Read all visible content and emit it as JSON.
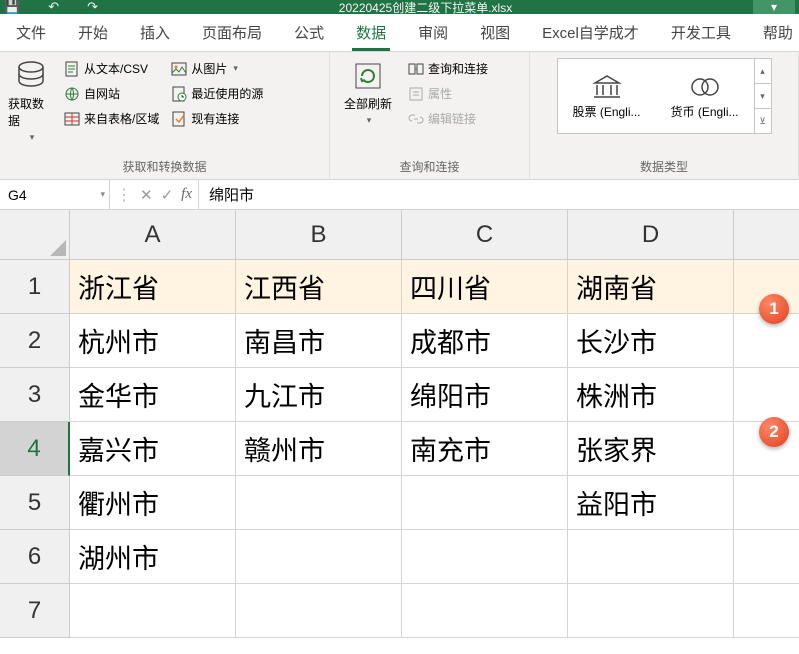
{
  "titlebar": {
    "filename": "20220425创建二级下拉菜单.xlsx"
  },
  "tabs": [
    "文件",
    "开始",
    "插入",
    "页面布局",
    "公式",
    "数据",
    "审阅",
    "视图",
    "Excel自学成才",
    "开发工具",
    "帮助"
  ],
  "active_tab_index": 5,
  "ribbon": {
    "group1": {
      "big": "获取数据",
      "items": [
        "从文本/CSV",
        "自网站",
        "来自表格/区域"
      ],
      "items2": [
        "从图片",
        "最近使用的源",
        "现有连接"
      ],
      "label": "获取和转换数据"
    },
    "group2": {
      "big": "全部刷新",
      "items": [
        "查询和连接",
        "属性",
        "编辑链接"
      ],
      "label": "查询和连接"
    },
    "group3": {
      "items": [
        "股票 (Engli...",
        "货币 (Engli..."
      ],
      "label": "数据类型"
    }
  },
  "namebox": "G4",
  "formula": "绵阳市",
  "chart_data": {
    "type": "table",
    "columns": [
      "A",
      "B",
      "C",
      "D"
    ],
    "rows": [
      "1",
      "2",
      "3",
      "4",
      "5",
      "6",
      "7"
    ],
    "data": [
      [
        "浙江省",
        "江西省",
        "四川省",
        "湖南省"
      ],
      [
        "杭州市",
        "南昌市",
        "成都市",
        "长沙市"
      ],
      [
        "金华市",
        "九江市",
        "绵阳市",
        "株洲市"
      ],
      [
        "嘉兴市",
        "赣州市",
        "南充市",
        "张家界"
      ],
      [
        "衢州市",
        "",
        "",
        "益阳市"
      ],
      [
        "湖州市",
        "",
        "",
        ""
      ],
      [
        "",
        "",
        "",
        ""
      ]
    ],
    "selected_cell": "G4",
    "active_row_header": 4
  },
  "badges": [
    "1",
    "2"
  ]
}
